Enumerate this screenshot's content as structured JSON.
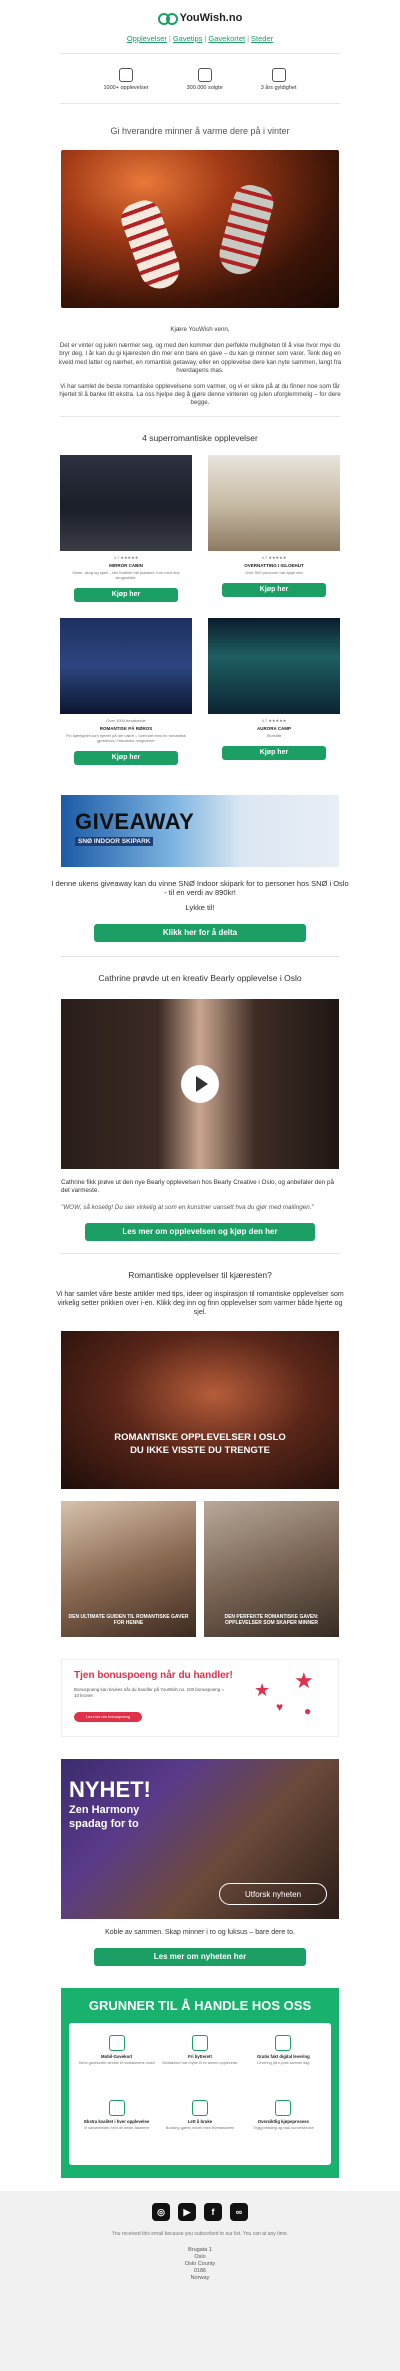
{
  "header": {
    "logo_text": "YouWish.no",
    "nav": [
      "Opplevelser",
      "Gavetips",
      "Gavekortet",
      "Steder"
    ],
    "separator": "|"
  },
  "usps": [
    {
      "label": "1000+ opplevelser",
      "icon": "gift-icon"
    },
    {
      "label": "300.000 solgte",
      "icon": "calendar-icon"
    },
    {
      "label": "3 års gyldighet",
      "icon": "hourglass-icon"
    }
  ],
  "tagline": "Gi hverandre minner å varme dere på i vinter",
  "intro": {
    "greeting": "Kjære YouWish venn,",
    "para1": "Det er vinter og julen nærmer seg, og med den kommer den perfekte muligheten til å vise hvor mye du bryr deg. I år kan du gi kjæresten din mer enn bare en gave – du kan gi minner som varer. Tenk deg en kveld med latter og nærhet, en romantisk getaway, eller en opplevelse dere kan nyte sammen, langt fra hverdagens mas.",
    "para2": "Vi har samlet de beste romantiske opplevelsene som varmer, og vi er sikre på at du finner noe som får hjertet til å banke litt ekstra. La oss hjelpe deg å gjøre denne vinteren og julen uforglemmelig – for dere begge."
  },
  "experiences_title": "4 superromantiske opplevelser",
  "cards": [
    {
      "name": "MIRROR CABIN",
      "sub": "Vinter, skog og speil – lær hoteller ble plassert, rom med stor skogsutsikt.",
      "meta": "4.7 ★★★★★",
      "button": "Kjøp her"
    },
    {
      "name": "OVERNATTING I IGLOEHUT",
      "sub": "",
      "meta": "Over 500 personer har kjøpt den",
      "button": "Kjøp her"
    },
    {
      "name": "ROMANTISK PÅ RØROS",
      "sub": "Fin kjærlighet som hjertet på det vakre – overnatt med en romantisk gjestehus i historiske omgivelser",
      "meta": "Over 1000 besøkende",
      "button": "Kjøp her"
    },
    {
      "name": "AURORA CAMP",
      "sub": "",
      "meta": "Storslått",
      "button": "Kjøp her"
    }
  ],
  "giveaway": {
    "banner_title": "GIVEAWAY",
    "banner_sub": "SNØ INDOOR SKIPARK",
    "text": "I denne ukens giveaway kan du vinne SNØ Indoor skipark for to personer hos SNØ i Oslo - til en verdi av 890kr!",
    "luck": "Lykke til!",
    "button": "Klikk her for å delta"
  },
  "video_section": {
    "title": "Cathrine prøvde ut en kreativ Bearly opplevelse i Oslo",
    "caption": "Cathrine fikk prøve ut den nye Bearly opplevelsen hos Bearly Creative i Oslo, og anbefaler den på det varmeste.",
    "quote": "\"WOW, så koselig! Du sier virkelig at som en kunstner uansett hva du gjør med mailingen.\"",
    "button": "Les mer om opplevelsen og kjøp den her"
  },
  "romance": {
    "title": "Romantiske opplevelser til kjæresten?",
    "text": "Vi har samlet våre beste artikler med tips, ideer og inspirasjon til romantiske opplevelser som virkelig setter prikken over i-en. Klikk deg inn og finn opplevelser som varmer både hjerte og sjel.",
    "big_title_1": "ROMANTISKE OPPLEVELSER I OSLO",
    "big_title_2": "DU IKKE VISSTE DU TRENGTE",
    "small1": "DEN ULTIMATE GUIDEN TIL ROMANTISKE GAVER FOR HENNE",
    "small2": "DEN PERFEKTE ROMANTISKE GAVEN: OPPLEVELSER SOM SKAPER MINNER"
  },
  "bonus": {
    "title": "Tjen bonuspoeng når du handler!",
    "text": "Bonuspoeng kan brukes når du handler på YouWish.no. 100 bonuspoeng = 10 kroner.",
    "button": "Les mer om bonuspoeng"
  },
  "nyhet": {
    "title": "NYHET!",
    "sub1": "Zen Harmony",
    "sub2": "spadag for to",
    "button": "Utforsk nyheten",
    "text": "Koble av sammen. Skap minner i ro og luksus – bare dere to.",
    "read_more": "Les mer om nyheten her"
  },
  "reasons": {
    "title": "GRUNNER TIL Å HANDLE HOS OSS",
    "items": [
      {
        "t": "Mobil-Gavekort",
        "d": "Send gavekortet direkte til mottakerens mobil"
      },
      {
        "t": "Fri bytterett",
        "d": "Mottakeren kan bytte til en annen opplevelse"
      },
      {
        "t": "Gratis fakt digital levering",
        "d": "Levering på e-post samme dag"
      },
      {
        "t": "Ekstra kvalitet i hver opplevelse",
        "d": "Vi samarbeider med de beste aktørene"
      },
      {
        "t": "Lett å bruke",
        "d": "Booking gjøres enkelt med leverandøren"
      },
      {
        "t": "Oversiktlig kjøpeprosess",
        "d": "Trygg betaling og rask kundeservice"
      }
    ]
  },
  "footer": {
    "social": [
      "instagram-icon",
      "youtube-icon",
      "facebook-icon",
      "link-icon"
    ],
    "note": "You received this email because you subscribed to our list. You can at any time.",
    "address": [
      "Brugata 1",
      "Oslo",
      "Oslo County",
      "0186",
      "Norway"
    ]
  },
  "colors": {
    "brand_green": "#1b9f64",
    "bonus_red": "#e0314b",
    "reasons_green": "#18b26e"
  }
}
